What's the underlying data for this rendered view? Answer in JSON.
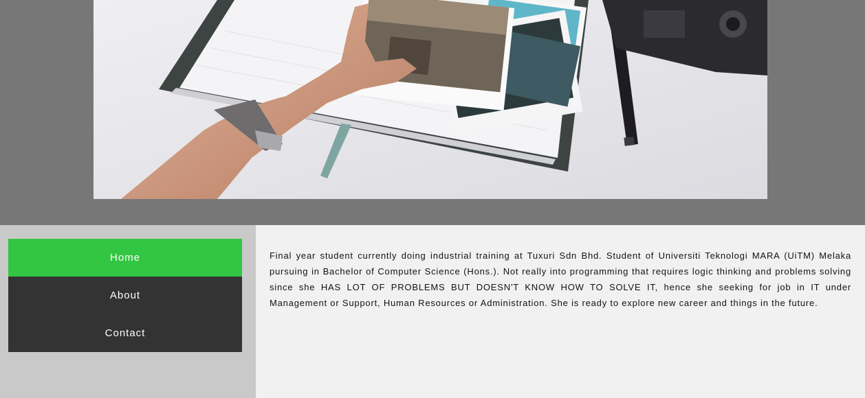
{
  "banner": {
    "image": "hand-holding-photos-on-notebook-with-camera-and-pen"
  },
  "nav": {
    "items": [
      {
        "label": "Home",
        "active": true
      },
      {
        "label": "About",
        "active": false
      },
      {
        "label": "Contact",
        "active": false
      }
    ]
  },
  "main": {
    "bio": "Final year student currently doing industrial training at Tuxuri Sdn Bhd. Student of Universiti Teknologi MARA (UiTM) Melaka pursuing in Bachelor of Computer Science (Hons.). Not really into programming that requires logic thinking and problems solving since she HAS LOT OF PROBLEMS BUT DOESN'T KNOW HOW TO SOLVE IT, hence she seeking for job in IT under Management or Support, Human Resources or Administration. She is ready to explore new career and things in the future."
  },
  "colors": {
    "header_bg": "#777777",
    "sidebar_bg": "#c9c9c9",
    "nav_active": "#33c642",
    "nav_default": "#333333",
    "content_bg": "#f1f1f1"
  }
}
